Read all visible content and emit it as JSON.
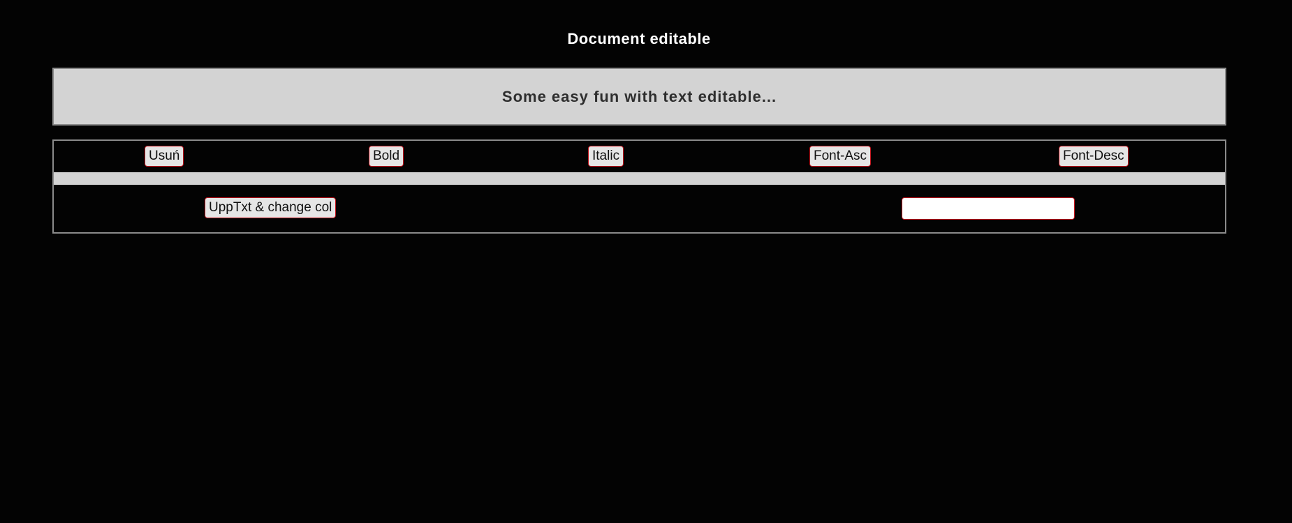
{
  "page": {
    "title": "Document editable"
  },
  "editor": {
    "text": "Some easy fun with text editable..."
  },
  "toolbar": {
    "usun_label": "Usuń",
    "bold_label": "Bold",
    "italic_label": "Italic",
    "font_asc_label": "Font-Asc",
    "font_desc_label": "Font-Desc",
    "upptxt_label": "UppTxt & change col"
  },
  "input": {
    "value": "",
    "placeholder": ""
  },
  "colors": {
    "background": "#030303",
    "panel": "#d3d3d3",
    "button_border": "#c0141c",
    "button_bg": "#e6e6e6"
  }
}
